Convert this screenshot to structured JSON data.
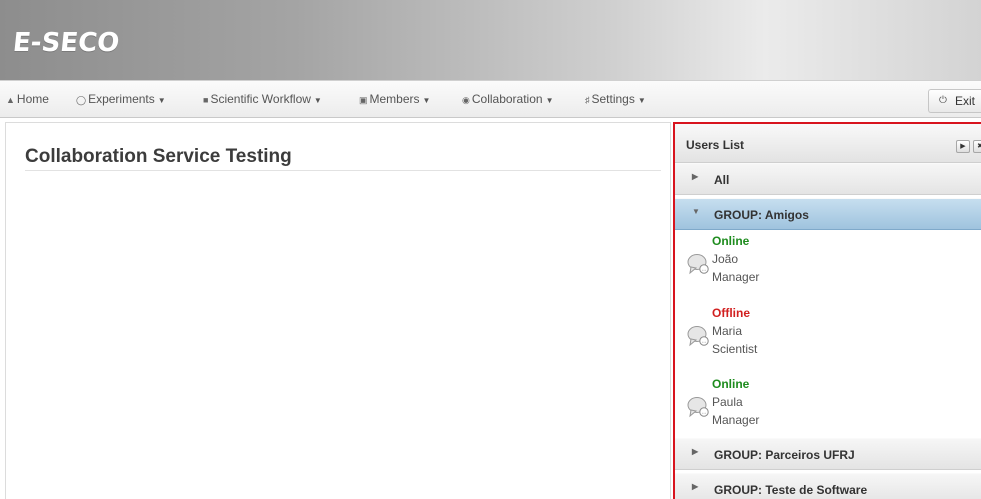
{
  "app": {
    "logo": "E-SECO"
  },
  "nav": {
    "home": "Home",
    "experiments": "Experiments",
    "scientific_workflow": "Scientific Workflow",
    "members": "Members",
    "collaboration": "Collaboration",
    "settings": "Settings",
    "exit": "Exit"
  },
  "page": {
    "title": "Collaboration Service Testing"
  },
  "users_panel": {
    "title": "Users List",
    "groups": {
      "all": "All",
      "amigos": "GROUP: Amigos",
      "parceiros": "GROUP: Parceiros UFRJ",
      "teste": "GROUP: Teste de Software"
    },
    "users": [
      {
        "status": "Online",
        "name": "João",
        "role": "Manager"
      },
      {
        "status": "Offline",
        "name": "Maria",
        "role": "Scientist"
      },
      {
        "status": "Online",
        "name": "Paula",
        "role": "Manager"
      }
    ]
  },
  "colors": {
    "panel_border": "#d8141e",
    "active_group": "#a9cae3",
    "online": "#1e8c1e",
    "offline": "#d11f1f"
  }
}
